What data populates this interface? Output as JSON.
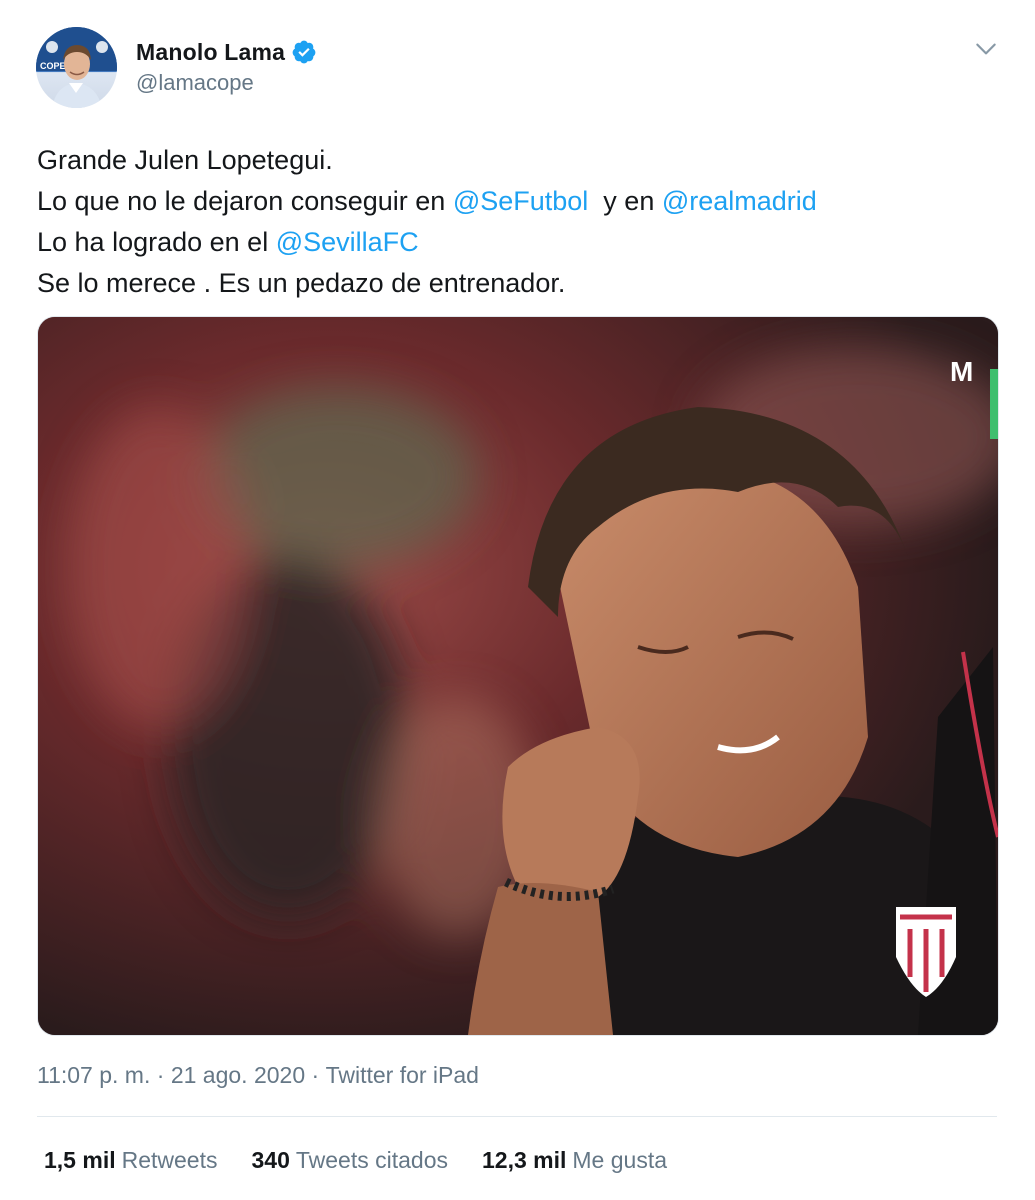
{
  "author": {
    "display_name": "Manolo Lama",
    "handle": "@lamacope",
    "verified": true,
    "avatar_icon": "profile-photo",
    "avatar_badge_text": "COPE"
  },
  "tweet": {
    "lines": [
      [
        {
          "t": "Grande Julen Lopetegui."
        }
      ],
      [
        {
          "t": "Lo que no le dejaron conseguir en "
        },
        {
          "t": "@SeFutbol",
          "mention": true
        },
        {
          "t": "  y en "
        },
        {
          "t": "@realmadrid",
          "mention": true
        }
      ],
      [
        {
          "t": "Lo ha logrado en el "
        },
        {
          "t": "@SevillaFC",
          "mention": true
        }
      ],
      [
        {
          "t": "Se lo merece . Es un pedazo de entrenador."
        }
      ]
    ]
  },
  "media": {
    "broadcaster_logo": "M"
  },
  "meta": {
    "time": "11:07 p. m.",
    "separator": "·",
    "date": "21 ago. 2020",
    "source": "Twitter for iPad"
  },
  "stats": [
    {
      "num": "1,5 mil",
      "label": "Retweets"
    },
    {
      "num": "340",
      "label": "Tweets citados"
    },
    {
      "num": "12,3 mil",
      "label": "Me gusta"
    }
  ],
  "colors": {
    "accent": "#1da1f2",
    "text": "#14171a",
    "secondary": "#657786",
    "divider": "#e1e8ed"
  }
}
